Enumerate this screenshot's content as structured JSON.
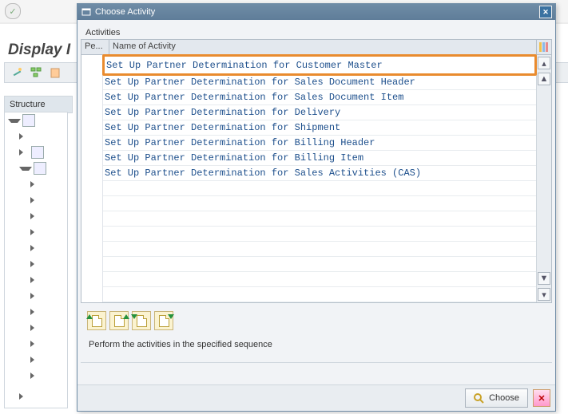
{
  "background": {
    "title": "Display I",
    "structure_label": "Structure"
  },
  "modal": {
    "title": "Choose Activity",
    "group_label": "Activities",
    "col1": "Pe...",
    "col2": "Name of Activity",
    "rows": [
      "Set Up Partner Determination for Customer Master",
      "Set Up Partner Determination for Sales Document Header",
      "Set Up Partner Determination for Sales Document Item",
      "Set Up Partner Determination for Delivery",
      "Set Up Partner Determination for Shipment",
      "Set Up Partner Determination for Billing Header",
      "Set Up Partner Determination for Billing Item",
      "Set Up Partner Determination for Sales Activities (CAS)"
    ],
    "highlight_index": 0,
    "instruction": "Perform the activities in the specified sequence",
    "choose_label": "Choose"
  }
}
